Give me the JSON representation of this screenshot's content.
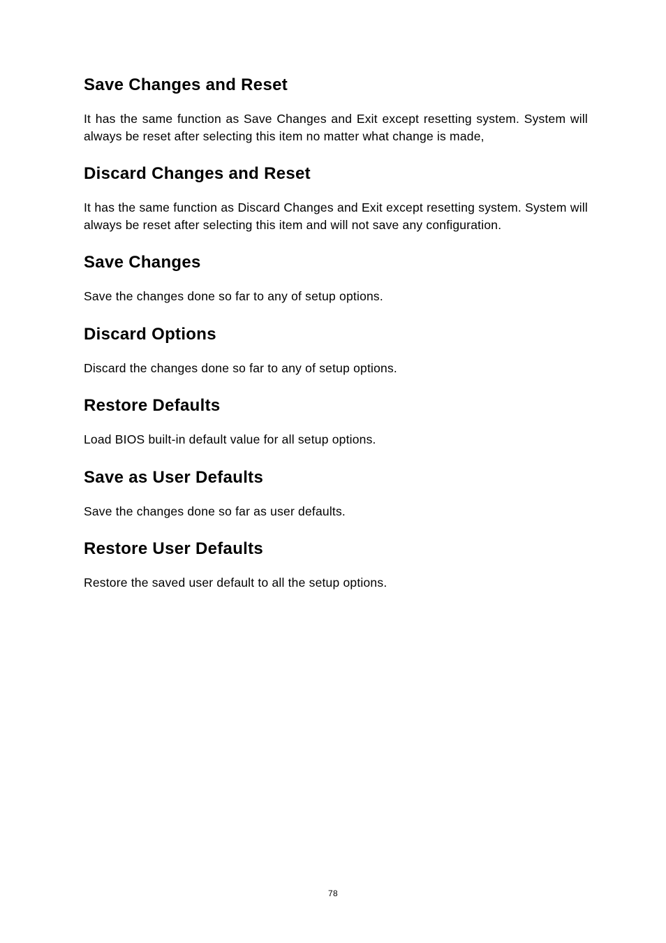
{
  "pageNumber": "78",
  "sections": [
    {
      "heading": "Save Changes and Reset",
      "body": "It has the same function as Save Changes and Exit except resetting system. System will always be reset after selecting this item no matter what change is made,",
      "justify": true
    },
    {
      "heading": "Discard Changes and Reset",
      "body": "It has the same function as Discard Changes and Exit except resetting system. System will always be reset after selecting this item and will not save any configuration.",
      "justify": true
    },
    {
      "heading": "Save Changes",
      "body": "Save the changes done so far to any of setup options.",
      "justify": false
    },
    {
      "heading": "Discard Options",
      "body": "Discard the changes done so far to any of setup options.",
      "justify": false
    },
    {
      "heading": "Restore Defaults",
      "body": "Load BIOS built-in default value for all setup options.",
      "justify": false
    },
    {
      "heading": "Save as User Defaults",
      "body": "Save the changes done so far as user defaults.",
      "justify": false
    },
    {
      "heading": "Restore User Defaults",
      "body": "Restore the saved user default to all the setup options.",
      "justify": false
    }
  ]
}
